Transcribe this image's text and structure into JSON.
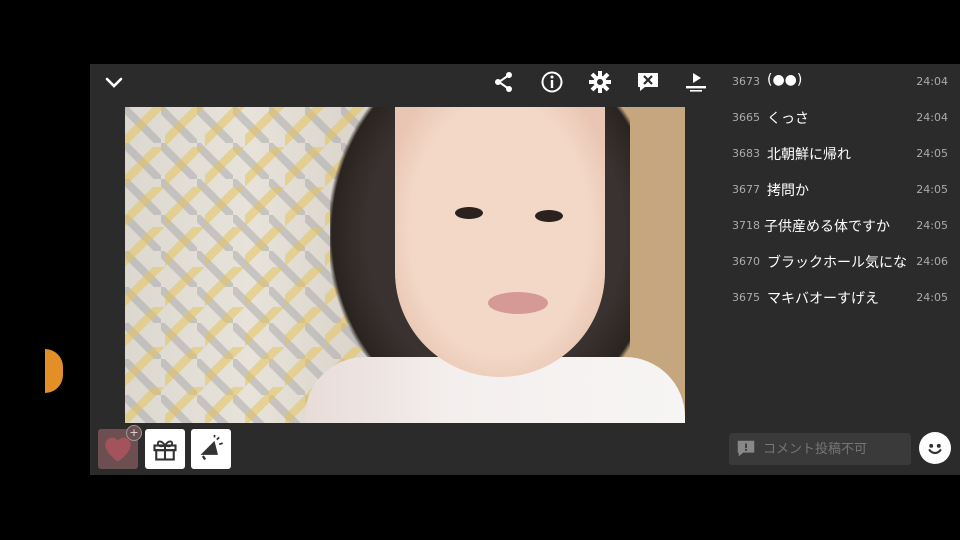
{
  "toolbar": {
    "icons": [
      "chevron-down-icon",
      "share-icon",
      "info-icon",
      "gear-icon",
      "close-comments-icon",
      "playlist-icon"
    ]
  },
  "comments": [
    {
      "num": "3673",
      "text": "(●●)",
      "time": "24:04"
    },
    {
      "num": "3665",
      "text": "くっさ",
      "time": "24:04"
    },
    {
      "num": "3683",
      "text": "北朝鮮に帰れ",
      "time": "24:05"
    },
    {
      "num": "3677",
      "text": "拷問か",
      "time": "24:05"
    },
    {
      "num": "3718",
      "text": "子供産める体ですか",
      "time": "24:05"
    },
    {
      "num": "3670",
      "text": "ブラックホール気にな",
      "time": "24:06"
    },
    {
      "num": "3675",
      "text": "マキバオーすげえ",
      "time": "24:05"
    }
  ],
  "comment_input": {
    "placeholder": "コメント投稿不可"
  },
  "bottom_buttons": {
    "heart_badge": "+"
  },
  "colors": {
    "panel": "#2b2b2b",
    "accent": "#e28f28"
  }
}
